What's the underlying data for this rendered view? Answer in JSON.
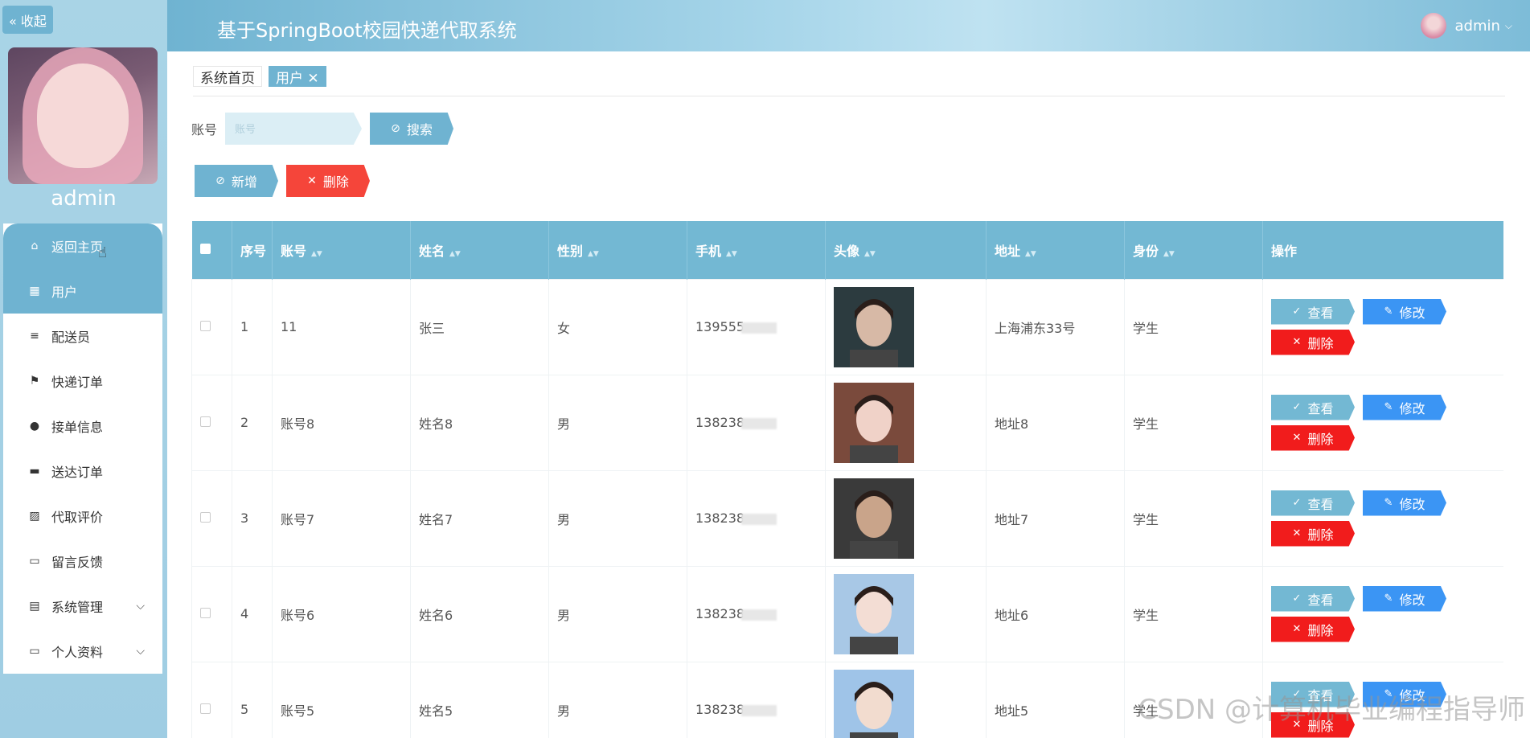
{
  "sidebar": {
    "collapse_label": "« 收起",
    "admin_name": "admin",
    "items": [
      {
        "label": "返回主页",
        "icon": "home-icon",
        "glyph": "⌂"
      },
      {
        "label": "用户",
        "icon": "grid-icon",
        "glyph": "▦"
      },
      {
        "label": "配送员",
        "icon": "list-icon",
        "glyph": "≡"
      },
      {
        "label": "快递订单",
        "icon": "flag-icon",
        "glyph": "⚑"
      },
      {
        "label": "接单信息",
        "icon": "user-icon",
        "glyph": "●"
      },
      {
        "label": "送达订单",
        "icon": "printer-icon",
        "glyph": "▬"
      },
      {
        "label": "代取评价",
        "icon": "chart-icon",
        "glyph": "▨"
      },
      {
        "label": "留言反馈",
        "icon": "monitor-icon",
        "glyph": "▭"
      },
      {
        "label": "系统管理",
        "icon": "clipboard-icon",
        "glyph": "▤"
      },
      {
        "label": "个人资料",
        "icon": "card-icon",
        "glyph": "▭"
      }
    ]
  },
  "header": {
    "title": "基于SpringBoot校园快递代取系统",
    "user": "admin"
  },
  "tabs": [
    "系统首页",
    "用户 ✕"
  ],
  "search": {
    "label": "账号",
    "placeholder": "账号",
    "button": "搜索"
  },
  "actions": {
    "add": "新增",
    "delete": "删除"
  },
  "table": {
    "columns": [
      "序号",
      "账号",
      "姓名",
      "性别",
      "手机",
      "头像",
      "地址",
      "身份",
      "操作"
    ],
    "rows": [
      {
        "index": "1",
        "account": "11",
        "name": "张三",
        "gender": "女",
        "phone": "139555",
        "address": "上海浦东33号",
        "role": "学生"
      },
      {
        "index": "2",
        "account": "账号8",
        "name": "姓名8",
        "gender": "男",
        "phone": "138238",
        "address": "地址8",
        "role": "学生"
      },
      {
        "index": "3",
        "account": "账号7",
        "name": "姓名7",
        "gender": "男",
        "phone": "138238",
        "address": "地址7",
        "role": "学生"
      },
      {
        "index": "4",
        "account": "账号6",
        "name": "姓名6",
        "gender": "男",
        "phone": "138238",
        "address": "地址6",
        "role": "学生"
      },
      {
        "index": "5",
        "account": "账号5",
        "name": "姓名5",
        "gender": "男",
        "phone": "138238",
        "address": "地址5",
        "role": "学生"
      }
    ],
    "ops": {
      "view": "查看",
      "edit": "修改",
      "delete": "删除"
    }
  },
  "watermark": "CSDN @计算机毕业编程指导师",
  "colors": {
    "accent": "#73b8d3",
    "danger": "#f11c1c",
    "edit": "#3b95f4"
  }
}
